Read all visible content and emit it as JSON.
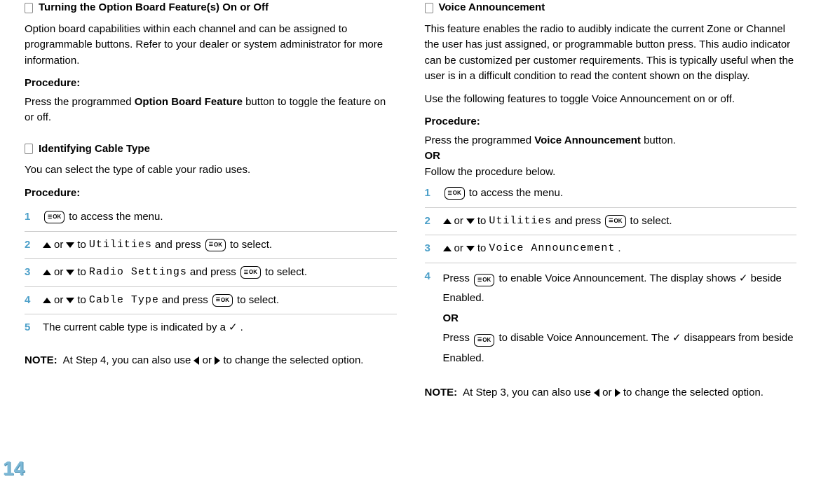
{
  "pageNumber": "14",
  "left": {
    "section1": {
      "heading": "Turning the Option Board Feature(s) On or Off",
      "intro": "Option board capabilities within each channel and can be assigned to programmable buttons. Refer to your dealer or system administrator for more information.",
      "procLabel": "Procedure:",
      "procText1": "Press the programmed ",
      "procBold": "Option Board Feature",
      "procText2": " button to toggle the feature on or off."
    },
    "section2": {
      "heading": "Identifying Cable Type",
      "intro": "You can select the type of cable your radio uses.",
      "procLabel": "Procedure:",
      "step1": {
        "num": "1",
        "ok": "OK",
        "text": " to access the menu."
      },
      "step2": {
        "num": "2",
        "or": " or ",
        "to": " to ",
        "menu": "Utilities",
        "and": " and press ",
        "ok": "OK",
        "select": " to select."
      },
      "step3": {
        "num": "3",
        "or": " or ",
        "to": " to ",
        "menu": "Radio Settings",
        "and": " and press ",
        "ok": "OK",
        "select": " to select."
      },
      "step4": {
        "num": "4",
        "or": " or ",
        "to": " to ",
        "menu": "Cable Type",
        "and": " and press ",
        "ok": "OK",
        "select": " to select."
      },
      "step5": {
        "num": "5",
        "text1": "The current cable type is indicated by a ",
        "check": "✓",
        "text2": "."
      },
      "noteLabel": "NOTE:",
      "noteText1": "At Step 4, you can also use ",
      "noteOr": " or ",
      "noteText2": " to change the selected option."
    }
  },
  "right": {
    "section1": {
      "heading": "Voice Announcement",
      "intro": "This feature enables the radio to audibly indicate the current Zone or Channel the user has just assigned, or programmable button press. This audio indicator can be customized per customer requirements. This is typically useful when the user is in a difficult condition to read the content shown on the display.",
      "use": "Use the following features to toggle Voice Announcement on or off.",
      "procLabel": "Procedure:",
      "procText1": "Press the programmed ",
      "procBold": "Voice Announcement",
      "procText2": " button.",
      "or": "OR",
      "follow": "Follow the procedure below.",
      "step1": {
        "num": "1",
        "ok": "OK",
        "text": " to access the menu."
      },
      "step2": {
        "num": "2",
        "or": " or ",
        "to": " to ",
        "menu": "Utilities",
        "and": " and press ",
        "ok": "OK",
        "select": " to select."
      },
      "step3": {
        "num": "3",
        "or": " or ",
        "to": " to ",
        "menu": "Voice Announcement",
        "period": "."
      },
      "step4": {
        "num": "4",
        "press": "Press ",
        "ok": "OK",
        "enable": " to enable Voice Announcement. The display shows ",
        "check": "✓",
        "beside": " beside Enabled.",
        "or": "OR",
        "press2": "Press ",
        "ok2": "OK",
        "disable": " to disable Voice Announcement. The ",
        "check2": "✓",
        "disappears": " disappears from beside Enabled."
      },
      "noteLabel": "NOTE:",
      "noteText1": "At Step 3, you can also use ",
      "noteOr": " or ",
      "noteText2": " to change the selected option."
    }
  }
}
